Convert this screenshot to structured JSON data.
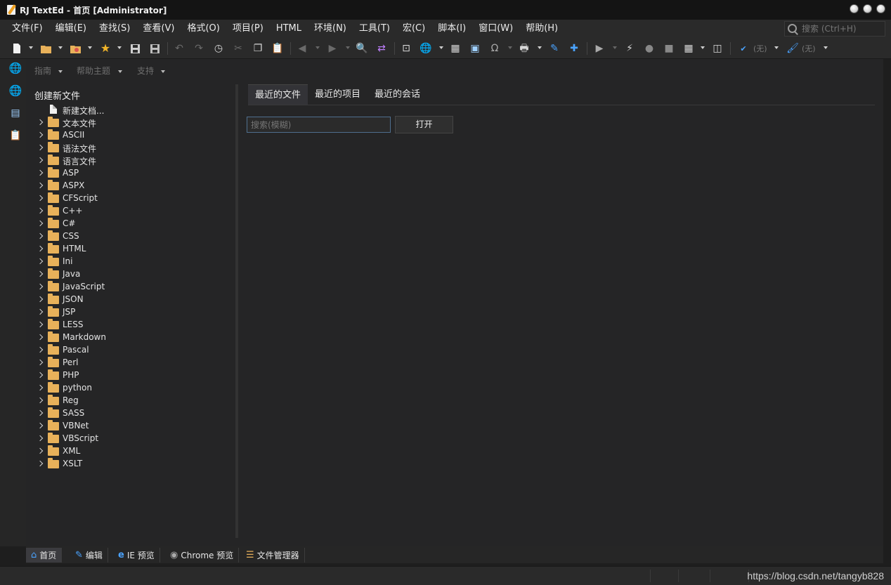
{
  "window": {
    "title": "RJ TextEd - 首页 [Administrator]"
  },
  "menu": [
    "文件(F)",
    "编辑(E)",
    "查找(S)",
    "查看(V)",
    "格式(O)",
    "项目(P)",
    "HTML",
    "环境(N)",
    "工具(T)",
    "宏(C)",
    "脚本(I)",
    "窗口(W)",
    "帮助(H)"
  ],
  "global_search": {
    "placeholder": "搜索 (Ctrl+H)"
  },
  "toolbar": {
    "spell_label": "(无)",
    "style_label": "(无)"
  },
  "subbar": [
    "指南",
    "帮助主题",
    "支持"
  ],
  "tree": {
    "title": "创建新文件",
    "new_doc": "新建文档...",
    "folders": [
      "文本文件",
      "ASCII",
      "语法文件",
      "语言文件",
      "ASP",
      "ASPX",
      "CFScript",
      "C++",
      "C#",
      "CSS",
      "HTML",
      "Ini",
      "Java",
      "JavaScript",
      "JSON",
      "JSP",
      "LESS",
      "Markdown",
      "Pascal",
      "Perl",
      "PHP",
      "python",
      "Reg",
      "SASS",
      "VBNet",
      "VBScript",
      "XML",
      "XSLT"
    ]
  },
  "content": {
    "tabs": [
      "最近的文件",
      "最近的项目",
      "最近的会话"
    ],
    "search_placeholder": "搜索(模糊)",
    "open_label": "打开"
  },
  "bottom_tabs": [
    "首页",
    "编辑",
    "IE 预览",
    "Chrome 预览",
    "文件管理器"
  ],
  "watermark": "https://blog.csdn.net/tangyb828",
  "colors": {
    "accent_blue": "#3b8fd8",
    "folder": "#e8b15a",
    "background": "#252526"
  }
}
